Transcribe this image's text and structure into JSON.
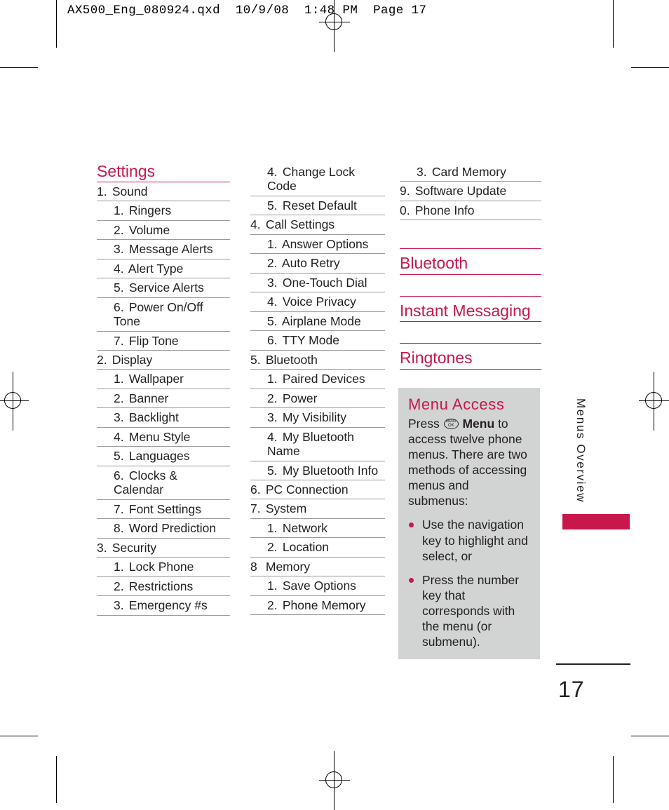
{
  "slug": "AX500_Eng_080924.qxd  10/9/08  1:48 PM  Page 17",
  "colors": {
    "accent": "#c8174b",
    "text": "#231f20",
    "rule": "#9a9a9a",
    "callout_bg": "#d2d3d3"
  },
  "column1": {
    "heading": "Settings",
    "rows": [
      {
        "level": 1,
        "num": "1.",
        "label": "Sound"
      },
      {
        "level": 2,
        "num": "1.",
        "label": "Ringers"
      },
      {
        "level": 2,
        "num": "2.",
        "label": "Volume"
      },
      {
        "level": 2,
        "num": "3.",
        "label": "Message Alerts"
      },
      {
        "level": 2,
        "num": "4.",
        "label": "Alert Type"
      },
      {
        "level": 2,
        "num": "5.",
        "label": "Service Alerts"
      },
      {
        "level": 2,
        "num": "6.",
        "label": "Power On/Off Tone"
      },
      {
        "level": 2,
        "num": "7.",
        "label": "Flip Tone"
      },
      {
        "level": 1,
        "num": "2.",
        "label": "Display"
      },
      {
        "level": 2,
        "num": "1.",
        "label": "Wallpaper"
      },
      {
        "level": 2,
        "num": "2.",
        "label": "Banner"
      },
      {
        "level": 2,
        "num": "3.",
        "label": "Backlight"
      },
      {
        "level": 2,
        "num": "4.",
        "label": "Menu Style"
      },
      {
        "level": 2,
        "num": "5.",
        "label": "Languages"
      },
      {
        "level": 2,
        "num": "6.",
        "label": "Clocks & Calendar"
      },
      {
        "level": 2,
        "num": "7.",
        "label": "Font Settings"
      },
      {
        "level": 2,
        "num": "8.",
        "label": "Word Prediction"
      },
      {
        "level": 1,
        "num": "3.",
        "label": "Security"
      },
      {
        "level": 2,
        "num": "1.",
        "label": "Lock Phone"
      },
      {
        "level": 2,
        "num": "2.",
        "label": "Restrictions"
      },
      {
        "level": 2,
        "num": "3.",
        "label": "Emergency #s"
      }
    ]
  },
  "column2": {
    "rows": [
      {
        "level": 2,
        "num": "4.",
        "label": "Change Lock Code"
      },
      {
        "level": 2,
        "num": "5.",
        "label": "Reset Default"
      },
      {
        "level": 1,
        "num": "4.",
        "label": "Call Settings"
      },
      {
        "level": 2,
        "num": "1.",
        "label": "Answer Options"
      },
      {
        "level": 2,
        "num": "2.",
        "label": "Auto Retry"
      },
      {
        "level": 2,
        "num": "3.",
        "label": "One-Touch Dial"
      },
      {
        "level": 2,
        "num": "4.",
        "label": "Voice Privacy"
      },
      {
        "level": 2,
        "num": "5.",
        "label": "Airplane Mode"
      },
      {
        "level": 2,
        "num": "6.",
        "label": "TTY Mode"
      },
      {
        "level": 1,
        "num": "5.",
        "label": "Bluetooth"
      },
      {
        "level": 2,
        "num": "1.",
        "label": "Paired Devices"
      },
      {
        "level": 2,
        "num": "2.",
        "label": "Power"
      },
      {
        "level": 2,
        "num": "3.",
        "label": "My Visibility"
      },
      {
        "level": 2,
        "num": "4.",
        "label": "My Bluetooth Name"
      },
      {
        "level": 2,
        "num": "5.",
        "label": "My Bluetooth Info"
      },
      {
        "level": 1,
        "num": "6.",
        "label": "PC Connection"
      },
      {
        "level": 1,
        "num": "7.",
        "label": "System"
      },
      {
        "level": 2,
        "num": "1.",
        "label": "Network"
      },
      {
        "level": 2,
        "num": "2.",
        "label": "Location"
      },
      {
        "level": 1,
        "num": "8",
        "label": "Memory"
      },
      {
        "level": 2,
        "num": "1.",
        "label": "Save Options"
      },
      {
        "level": 2,
        "num": "2.",
        "label": "Phone Memory"
      }
    ]
  },
  "column3": {
    "rows": [
      {
        "level": 2,
        "num": "3.",
        "label": "Card Memory"
      },
      {
        "level": 1,
        "num": "9.",
        "label": "Software Update"
      },
      {
        "level": 1,
        "num": "0.",
        "label": "Phone Info"
      }
    ],
    "headings": [
      "Bluetooth",
      "Instant Messaging",
      "Ringtones"
    ]
  },
  "callout": {
    "title": "Menu Access",
    "intro_before_key": "Press",
    "key_icon_top": "MENU",
    "key_icon_bottom": "OK",
    "key_label": "Menu",
    "intro_after_key": "to access twelve phone menus. There are two methods of accessing menus and submenus:",
    "bullets": [
      "Use the navigation key to highlight and select, or",
      "Press the number key that corresponds with the menu (or submenu)."
    ]
  },
  "side_tab": {
    "label": "Menus Overview"
  },
  "folio": {
    "page_number": "17"
  }
}
